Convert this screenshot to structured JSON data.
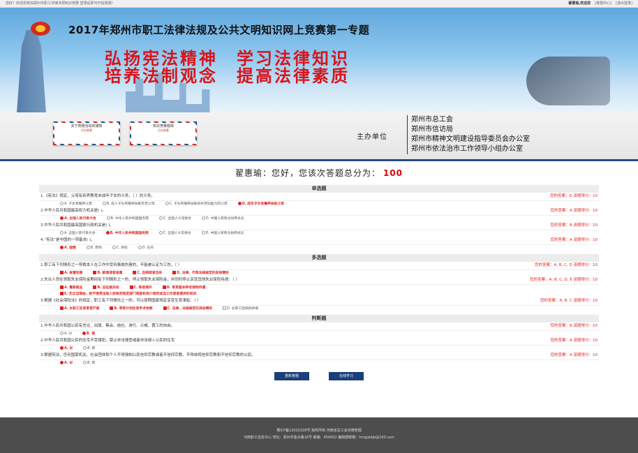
{
  "topbar": {
    "left": "您好！欢迎您参加郑州市职工法律法规知识竞赛 登录后即可开始答题！",
    "user": "翟惠瑜,欢迎您",
    "links": [
      "[答题中心]",
      "[退出登录]"
    ]
  },
  "banner": {
    "title": "2017年郑州市职工法律法规及公共文明知识网上竞赛第一专题",
    "slogan1": "弘扬宪法精神　学习法律知识",
    "slogan2": "培养法制观念　提高法律素质"
  },
  "envelopes": [
    {
      "title": "关于竞赛活动的通知",
      "sub": "点击查看"
    },
    {
      "title": "知识竞赛题库",
      "sub": "点击查看"
    }
  ],
  "org": {
    "label": "主办单位",
    "items": [
      "郑州市总工会",
      "郑州市信访局",
      "郑州市精神文明建设指导委员会办公室",
      "郑州市依法治市工作领导小组办公室"
    ]
  },
  "welcome": {
    "text": "翟惠瑜：您好，您该次答题总分为：",
    "score": "100"
  },
  "sections": [
    {
      "title": "单选题",
      "questions": [
        {
          "q": "1.《宪法》规定，父母有抚养教育未成年子女的义务，（ ）的义务。",
          "score": "您的答案：D 该题得分：10",
          "options": [
            {
              "t": "A. 子女有赡养父母",
              "s": false
            },
            {
              "t": "B. 成人子女有赡养扶助年老父母",
              "s": false
            },
            {
              "t": "C. 子女有赡养扶助丧失劳动能力的父母",
              "s": false
            },
            {
              "t": "D. 成年子女有赡养扶助父母",
              "s": true
            }
          ]
        },
        {
          "q": "2.中华人民共和国最高权力机关是( )。",
          "score": "您的答案：A 该题得分：10",
          "options": [
            {
              "t": "A. 全国人民代表大会",
              "s": true
            },
            {
              "t": "B. 中华人民共和国国务院",
              "s": false
            },
            {
              "t": "C. 全国人大常委会",
              "s": false
            },
            {
              "t": "D. 中国人民政治协商会议",
              "s": false
            }
          ]
        },
        {
          "q": "3.中华人民共和国最高国家行政机关是( )。",
          "score": "您的答案：B 该题得分：10",
          "options": [
            {
              "t": "A. 全国人民代表大会",
              "s": false
            },
            {
              "t": "B. 中华人民共和国国务院",
              "s": true
            },
            {
              "t": "C. 全国人大常委会",
              "s": false
            },
            {
              "t": "D. 中国人民政治协商会议",
              "s": false
            }
          ]
        },
        {
          "q": "4.“宪法”是中国的一项基本( )。",
          "score": "您的答案：A 该题得分：10",
          "options": [
            {
              "t": "A. 国策",
              "s": true
            },
            {
              "t": "B. 原则",
              "s": false
            },
            {
              "t": "C. 目标",
              "s": false
            },
            {
              "t": "D. 任务",
              "s": false
            }
          ]
        }
      ]
    },
    {
      "title": "多选题",
      "questions": [
        {
          "q": "1.职工有下列情形之一导致本人在工作中受到事故伤害的，不能被认定为工伤。（ ）",
          "score": "您的答案：A, B, C, D 该题得分：10",
          "options": [
            {
              "t": "A. 故意犯罪",
              "s": true
            },
            {
              "t": "B. 醉酒或者吸毒",
              "s": true
            },
            {
              "t": "C. 自残或者自杀",
              "s": true
            },
            {
              "t": "D. 法律、行政法规规定的其他情形",
              "s": true
            }
          ]
        },
        {
          "q": "2.失业人员在领取失业保险金期间有下列情形之一的，停止领取失业保险金，并同时停止享受其他失业保险待遇：（ ）",
          "score": "您的答案：A, B, C, D, E 该题得分：10",
          "options": [
            {
              "t": "A. 重新就业",
              "s": true
            },
            {
              "t": "B. 应征服兵役",
              "s": true
            },
            {
              "t": "C. 移居境外",
              "s": true
            },
            {
              "t": "D. 享受基本养老保险待遇",
              "s": true
            }
          ]
        },
        {
          "q": "",
          "score": "",
          "options": [
            {
              "t": "E. 无正当理由，拒不接受当地人民政府指定部门或者机构介绍的适当工作或者提供的培训",
              "s": true
            }
          ]
        },
        {
          "q": "3.根据《社会保险法》的规定，职工有下列情形之一的，可以按照国家规定享受生育津贴：（ ）",
          "score": "您的答案：A, B, C 该题得分：10",
          "options": [
            {
              "t": "A. 女职工生育享受产假",
              "s": true
            },
            {
              "t": "B. 享受计划生育手术休假",
              "s": true
            },
            {
              "t": "C. 法律、法规规定的其他情形",
              "s": true
            },
            {
              "t": "D. 女职工因病病休假",
              "s": false
            }
          ]
        }
      ]
    },
    {
      "title": "判断题",
      "questions": [
        {
          "q": "1.中华人民共和国公民有言论、出版、集会、结社、游行、示威、罢工的自由。",
          "score": "您的答案：B 该题得分：10",
          "options": [
            {
              "t": "A. 对",
              "s": false
            },
            {
              "t": "B. 错",
              "s": true
            }
          ]
        },
        {
          "q": "2.中华人民共和国公民的住宅不受侵犯。禁止非法搜查或者非法侵入公民的住宅",
          "score": "您的答案：A 该题得分：10",
          "options": [
            {
              "t": "A. 对",
              "s": true
            },
            {
              "t": "B. 错",
              "s": false
            }
          ]
        },
        {
          "q": "3.根据宪法，任何国家机关、社会团体和个人不得强制公民信仰宗教或者不信仰宗教，不得歧视信仰宗教和不信仰宗教的公民。",
          "score": "您的答案：A 该题得分：10",
          "options": [
            {
              "t": "A. 对",
              "s": true
            },
            {
              "t": "B. 错",
              "s": false
            }
          ]
        }
      ]
    }
  ],
  "buttons": {
    "retry": "重新答题",
    "study": "在线学习"
  },
  "footer": {
    "line1": "豫ICP备12010228号 版权所有 河南省总工会法律管理",
    "line2": "河南职工信息中心 地址：郑州市金水路16号 邮编：450002 编辑部邮箱：hnzgwbjb@163.com"
  }
}
